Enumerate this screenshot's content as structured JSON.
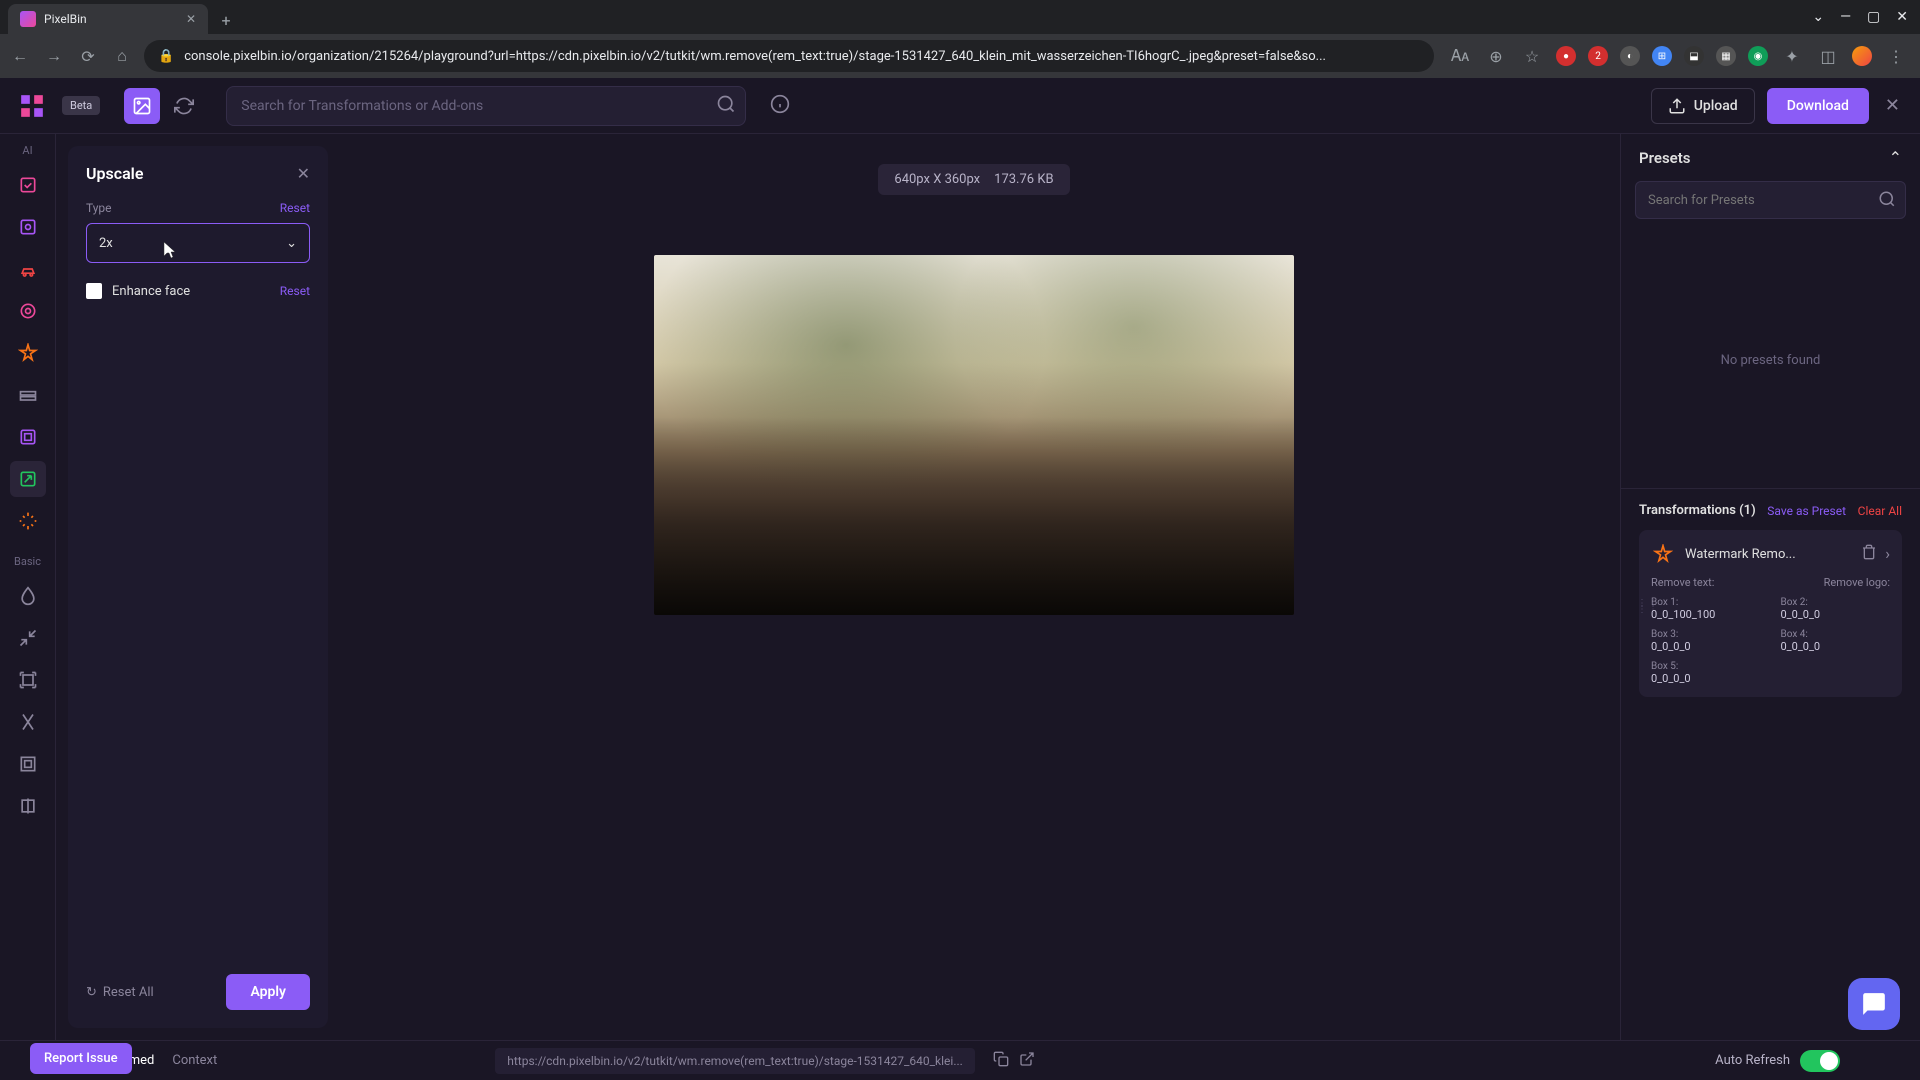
{
  "browser": {
    "tab_title": "PixelBin",
    "url": "console.pixelbin.io/organization/215264/playground?url=https://cdn.pixelbin.io/v2/tutkit/wm.remove(rem_text:true)/stage-1531427_640_klein_mit_wasserzeichen-TI6hogrC_.jpeg&preset=false&so..."
  },
  "header": {
    "beta": "Beta",
    "search_placeholder": "Search for Transformations or Add-ons",
    "upload": "Upload",
    "download": "Download"
  },
  "rail": {
    "ai_label": "AI",
    "basic_label": "Basic"
  },
  "panel": {
    "title": "Upscale",
    "type_label": "Type",
    "type_reset": "Reset",
    "type_value": "2x",
    "enhance_label": "Enhance face",
    "enhance_reset": "Reset",
    "reset_all": "Reset All",
    "apply": "Apply"
  },
  "canvas": {
    "dimensions": "640px X 360px",
    "size": "173.76 KB"
  },
  "presets": {
    "title": "Presets",
    "search_placeholder": "Search for Presets",
    "empty": "No presets found"
  },
  "transforms": {
    "title": "Transformations (1)",
    "save_preset": "Save as Preset",
    "clear_all": "Clear All",
    "item": {
      "name": "Watermark Remo...",
      "remove_text_label": "Remove text:",
      "remove_logo_label": "Remove logo:",
      "boxes": [
        {
          "label": "Box 1:",
          "val": "0_0_100_100"
        },
        {
          "label": "Box 2:",
          "val": "0_0_0_0"
        },
        {
          "label": "Box 3:",
          "val": "0_0_0_0"
        },
        {
          "label": "Box 4:",
          "val": "0_0_0_0"
        },
        {
          "label": "Box 5:",
          "val": "0_0_0_0"
        }
      ]
    }
  },
  "bottom": {
    "tab_transformed": "Transformed",
    "tab_context": "Context",
    "url": "https://cdn.pixelbin.io/v2/tutkit/wm.remove(rem_text:true)/stage-1531427_640_klei...",
    "auto_refresh": "Auto Refresh"
  },
  "report_issue": "Report Issue"
}
